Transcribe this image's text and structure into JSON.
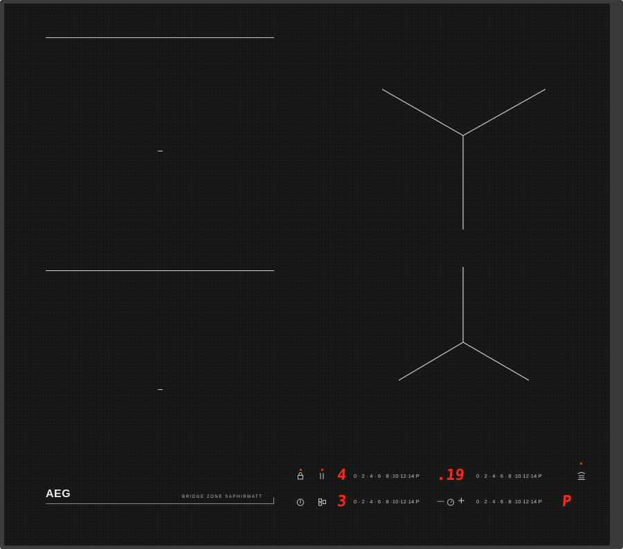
{
  "brand": {
    "logo": "AEG",
    "tagline": "BRIDGE ZONE SAPHIRMATT"
  },
  "controls": {
    "top_row": {
      "lock_icon": "lock-icon",
      "pause_icon": "pause-icon",
      "level_display": "4",
      "scale_left": "0 · 2 · 4 · 6 · 8 ·10·12·14 P",
      "timer_display": ".19",
      "scale_right": "0 · 2 · 4 · 6 · 8 ·10·12·14 P",
      "hob2hood_icon": "hob2hood-icon"
    },
    "bottom_row": {
      "power_icon": "power-icon",
      "bridge_icon": "bridge-icon",
      "level_display": "3",
      "scale_left": "0 · 2 · 4 · 6 · 8 ·10·12·14 P",
      "minus_label": "—",
      "timer_icon": "timer-icon",
      "plus_label": "+",
      "scale_right": "0 · 2 · 4 · 6 · 8 ·10·12·14 P",
      "level_display_right": "P"
    }
  },
  "colors": {
    "glass": "#161616",
    "frame": "#3c3c3e",
    "display": "#ff2a12",
    "markings": "#cfcfcf"
  }
}
